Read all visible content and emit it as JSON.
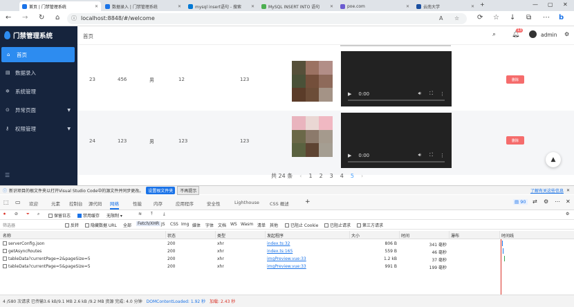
{
  "browser": {
    "tabs": [
      {
        "label": "首页 | 门禁管理系统",
        "active": true,
        "color": "#1a73e8"
      },
      {
        "label": "数据录入 | 门禁管理系统",
        "active": false,
        "color": "#1a73e8"
      },
      {
        "label": "mysql insert语句 - 搜索",
        "active": false,
        "color": "#0078d4"
      },
      {
        "label": "MySQL INSERT INTO 语句",
        "active": false,
        "color": "#4caf50"
      },
      {
        "label": "poe.com",
        "active": false,
        "color": "#6b5bd1"
      },
      {
        "label": "云南大学",
        "active": false,
        "color": "#1a4fa0"
      }
    ],
    "url": "localhost:8848/#/welcome"
  },
  "app": {
    "title": "门禁管理系统",
    "breadcrumb": "首页",
    "user": "admin",
    "notif_count": "13",
    "sidebar": [
      {
        "label": "首页",
        "icon": "home-icon",
        "active": true
      },
      {
        "label": "数据录入",
        "icon": "data-entry-icon",
        "active": false
      },
      {
        "label": "系统管理",
        "icon": "gear-icon",
        "active": false
      },
      {
        "label": "异常页面",
        "icon": "warning-icon",
        "active": false,
        "chevron": true
      },
      {
        "label": "权限管理",
        "icon": "key-icon",
        "active": false,
        "chevron": true
      }
    ]
  },
  "table": {
    "rows": [
      {
        "c1": "23",
        "c2": "456",
        "c3": "男",
        "c4": "12",
        "c5": "123",
        "time": "0:00",
        "delete": "删除",
        "mosaic": [
          "#56503a",
          "#9b7262",
          "#b28e87",
          "#4a5138",
          "#744f3b",
          "#8e6a5a",
          "#5b3c29",
          "#6c4d38",
          "#a49386"
        ]
      },
      {
        "c1": "24",
        "c2": "123",
        "c3": "男",
        "c4": "123",
        "c5": "123",
        "time": "0:00",
        "delete": "删除",
        "mosaic": [
          "#e9b4be",
          "#ead7d4",
          "#f0b8c2",
          "#6b6848",
          "#8c7a6b",
          "#a59a8d",
          "#5a6240",
          "#5e4432",
          "#a59e92"
        ]
      }
    ]
  },
  "pager": {
    "total": "共 24 条",
    "pages": [
      "1",
      "2",
      "3",
      "4",
      "5"
    ],
    "current": "5"
  },
  "devtools": {
    "notice": "新识项目的根文件夹以打开Visual Studio Code中的源文件并同步更改。",
    "notice_btn1": "设置根文件夹",
    "notice_btn2": "不再提示",
    "notice_link": "了解有关这些信息",
    "tabs": [
      "欢迎",
      "元素",
      "控制台",
      "源代码",
      "网络",
      "性能",
      "内存",
      "应用程序",
      "安全性",
      "Lighthouse",
      "CSS 概述"
    ],
    "active_tab": "网络",
    "issues": "90",
    "toolbar": {
      "preserve_log": "保留日志",
      "disable_cache": "禁用缓存",
      "throttle": "无限制"
    },
    "filter": {
      "placeholder": "筛选器",
      "invert": "反转",
      "hide_data": "隐藏数据 URL",
      "types": [
        "全部",
        "Fetch/XHR",
        "JS",
        "CSS",
        "Img",
        "媒体",
        "字体",
        "文档",
        "WS",
        "Wasm",
        "清单",
        "其他"
      ],
      "blocked_cookie": "已阻止 Cookie",
      "blocked_req": "已阻止请求",
      "third_party": "第三方请求"
    },
    "columns": [
      "名称",
      "状态",
      "类型",
      "发起程序",
      "大小",
      "时间",
      "瀑布",
      "时间线"
    ],
    "requests": [
      {
        "name": "serverConfig.json",
        "status": "200",
        "type": "xhr",
        "initiator": "index.ts:32",
        "size": "806 B",
        "time": "341 毫秒"
      },
      {
        "name": "getAsyncRoutes",
        "status": "200",
        "type": "xhr",
        "initiator": "index.ts:165",
        "size": "559 B",
        "time": "46 毫秒"
      },
      {
        "name": "tableData?currentPage=2&pageSize=5",
        "status": "200",
        "type": "xhr",
        "initiator": "imgPreview.vue:33",
        "size": "1.2 kB",
        "time": "37 毫秒"
      },
      {
        "name": "tableData?currentPage=5&pageSize=5",
        "status": "200",
        "type": "xhr",
        "initiator": "imgPreview.vue:33",
        "size": "991 B",
        "time": "199 毫秒"
      }
    ],
    "status_bar": {
      "summary": "4 /580 次请求  已传输3.6 kB/9.1 MB  2.6 kB /9.2 MB 资源  完成: 4.0 分钟",
      "dcl": "DOMContentLoaded: 1.92 秒",
      "load": "加载: 2.43 秒"
    }
  }
}
